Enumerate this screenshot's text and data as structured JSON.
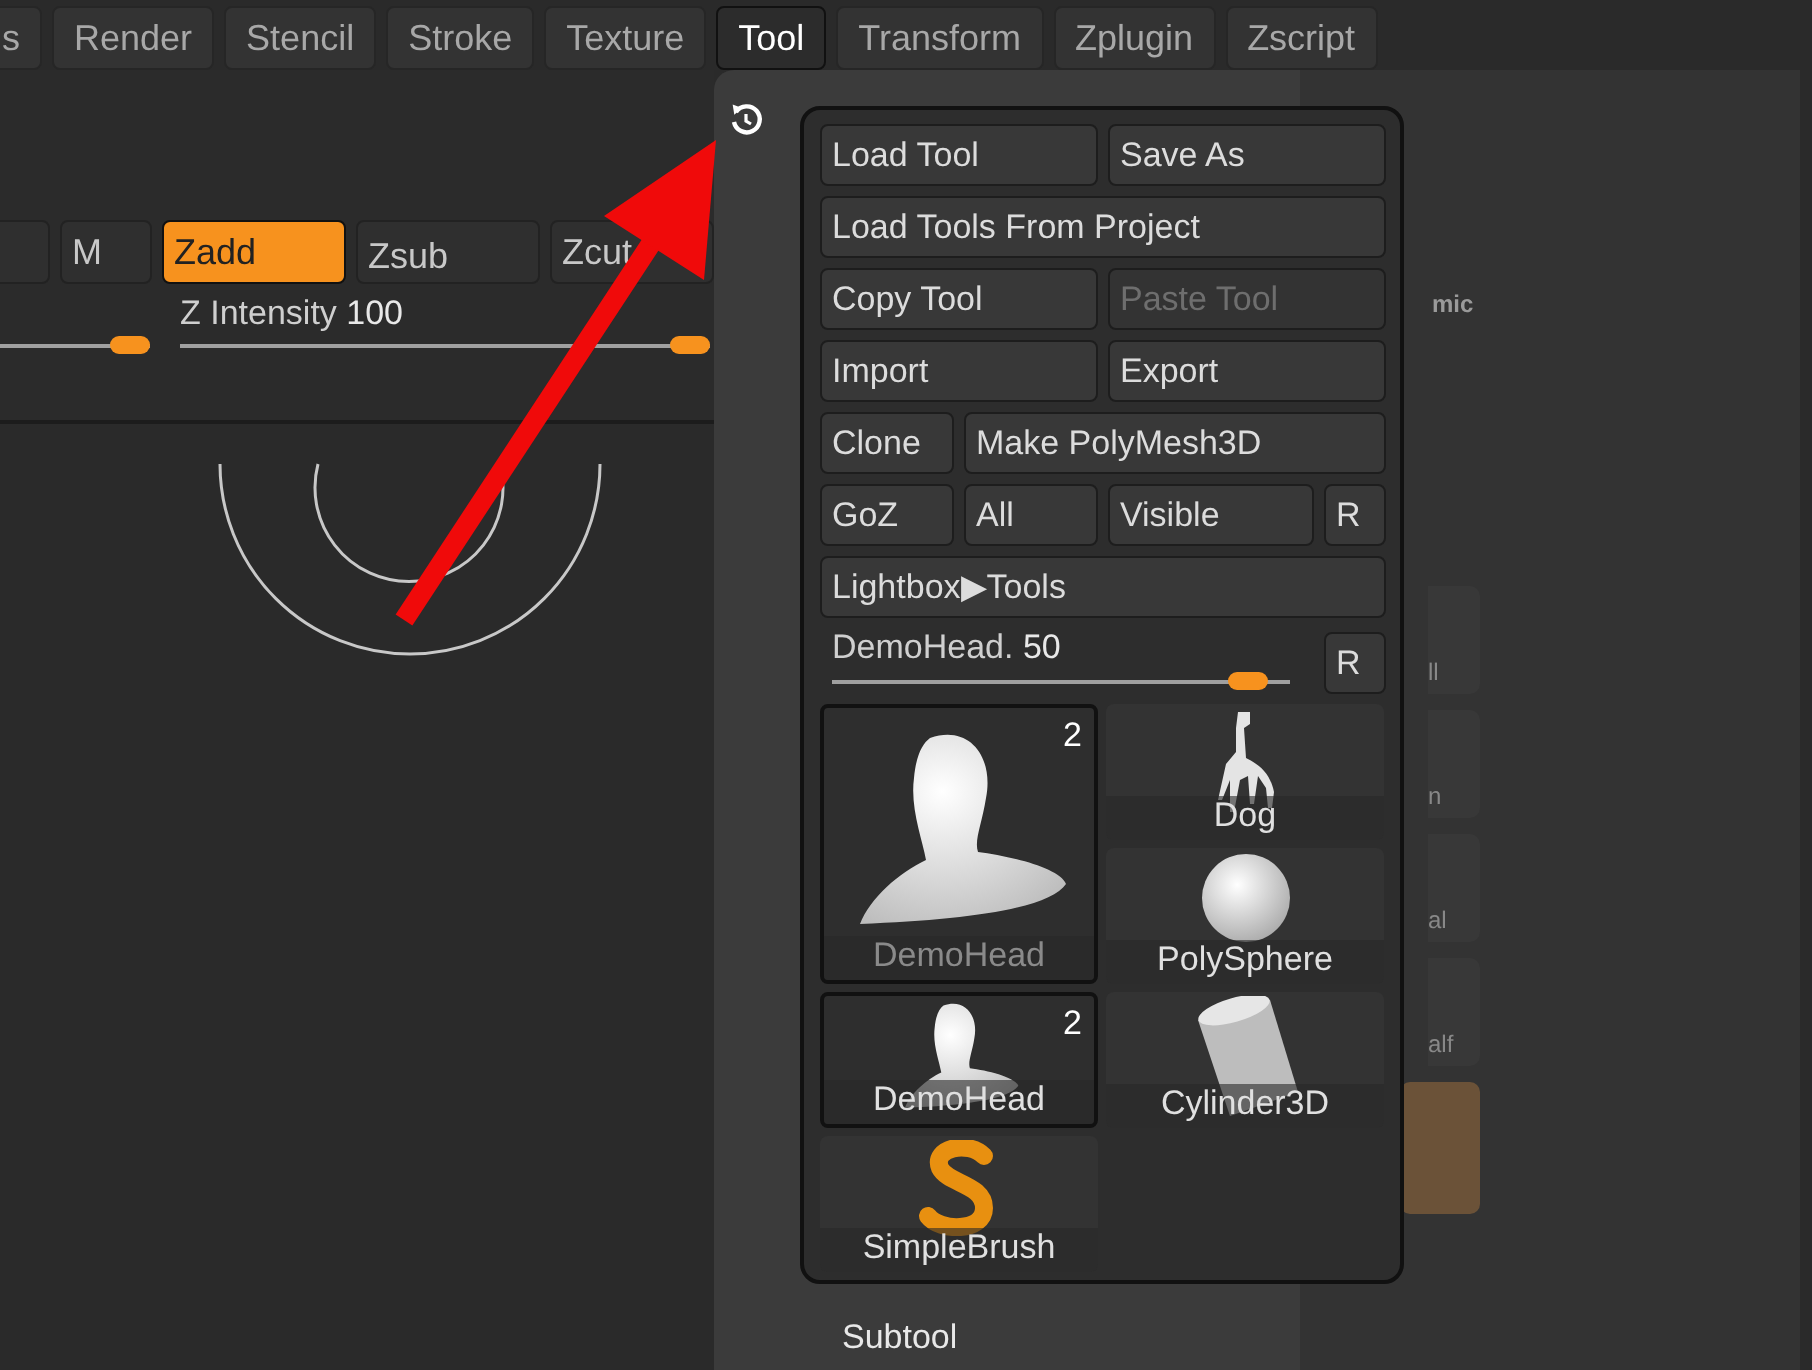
{
  "menu_tabs": [
    {
      "label": "s",
      "selected": false
    },
    {
      "label": "Render",
      "selected": false
    },
    {
      "label": "Stencil",
      "selected": false
    },
    {
      "label": "Stroke",
      "selected": false
    },
    {
      "label": "Texture",
      "selected": false
    },
    {
      "label": "Tool",
      "selected": true
    },
    {
      "label": "Transform",
      "selected": false
    },
    {
      "label": "Zplugin",
      "selected": false
    },
    {
      "label": "Zscript",
      "selected": false
    }
  ],
  "draw_modes": [
    {
      "label": "M",
      "selected": false
    },
    {
      "label": "Zadd",
      "selected": true
    },
    {
      "label": "Zsub",
      "selected": false
    },
    {
      "label": "Zcut",
      "selected": false
    }
  ],
  "sliders": [
    {
      "level": 1
    },
    {
      "label": "Z Intensity",
      "value": "100",
      "level": 1
    }
  ],
  "tool_palette": {
    "rows": [
      {
        "kind": "pair",
        "buttons": [
          {
            "label": "Load Tool",
            "disabled": false
          },
          {
            "label": "Save As",
            "disabled": false
          }
        ]
      },
      {
        "kind": "wide",
        "buttons": [
          {
            "label": "Load Tools From Project",
            "disabled": false
          }
        ]
      },
      {
        "kind": "pair",
        "buttons": [
          {
            "label": "Copy Tool",
            "disabled": false
          },
          {
            "label": "Paste Tool",
            "disabled": true
          }
        ]
      },
      {
        "kind": "pair",
        "buttons": [
          {
            "label": "Import",
            "disabled": false
          },
          {
            "label": "Export",
            "disabled": false
          }
        ]
      },
      {
        "kind": "split",
        "buttons": [
          {
            "label": "Clone",
            "disabled": false
          },
          {
            "label": "Make PolyMesh3D",
            "disabled": false
          }
        ]
      },
      {
        "kind": "quad",
        "buttons": [
          {
            "label": "GoZ",
            "disabled": false
          },
          {
            "label": "All",
            "disabled": false
          },
          {
            "label": "Visible",
            "disabled": false
          },
          {
            "label": "R",
            "disabled": false
          }
        ]
      },
      {
        "kind": "wide",
        "buttons": [
          {
            "label": "Lightbox▶Tools",
            "disabled": false
          }
        ]
      }
    ],
    "slider": {
      "label": "DemoHead.",
      "value": "50",
      "level": 0.95,
      "reset": "R"
    },
    "thumbnails": [
      {
        "kind": "head",
        "label": "DemoHead",
        "count": "2",
        "large": true,
        "selected": true,
        "dimmed": true
      },
      {
        "kind": "dog",
        "label": "Dog",
        "large": false,
        "selected": false,
        "dimmed": false
      },
      {
        "kind": "sphere",
        "label": "PolySphere",
        "large": false,
        "selected": false,
        "dimmed": false
      },
      {
        "kind": "head",
        "label": "DemoHead",
        "count": "2",
        "large": false,
        "selected": true,
        "dimmed": false
      },
      {
        "kind": "cylinder",
        "label": "Cylinder3D",
        "large": false,
        "selected": false,
        "dimmed": false
      },
      {
        "kind": "brush",
        "label": "SimpleBrush",
        "large": false,
        "selected": false,
        "dimmed": false
      }
    ]
  },
  "side_items": [
    {
      "kind": "text",
      "label": "mic"
    },
    {
      "kind": "icon",
      "label": "ll"
    },
    {
      "kind": "icon",
      "label": "n"
    },
    {
      "kind": "icon",
      "label": "al"
    },
    {
      "kind": "icon",
      "label": "alf"
    },
    {
      "kind": "swatch"
    }
  ],
  "subtool_label": "Subtool"
}
